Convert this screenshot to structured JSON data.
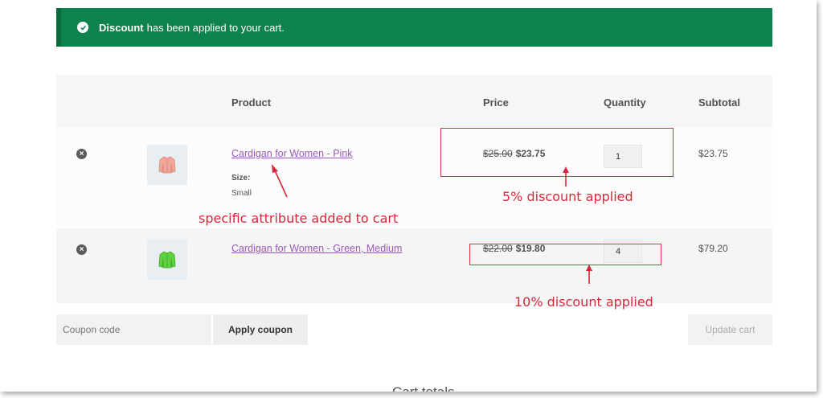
{
  "notice": {
    "strong": "Discount",
    "text": "has been applied to your cart.",
    "color": "#0f834d"
  },
  "table": {
    "headers": {
      "product": "Product",
      "price": "Price",
      "quantity": "Quantity",
      "subtotal": "Subtotal"
    }
  },
  "items": [
    {
      "name": "Cardigan for Women - Pink",
      "meta_label": "Size:",
      "meta_value": "Small",
      "old_price": "$25.00",
      "price": "$23.75",
      "quantity": "1",
      "subtotal": "$23.75",
      "remove_icon": "×",
      "thumb_icon": "pink-cardigan-icon"
    },
    {
      "name": "Cardigan for Women - Green, Medium",
      "old_price": "$22.00",
      "price": "$19.80",
      "quantity": "4",
      "subtotal": "$79.20",
      "remove_icon": "×",
      "thumb_icon": "green-cardigan-icon"
    }
  ],
  "annotations": {
    "attribute": "specific attribute  added to cart",
    "discount5": "5% discount applied",
    "discount10": "10% discount applied",
    "color": "#d7273a"
  },
  "actions": {
    "coupon_placeholder": "Coupon code",
    "apply": "Apply coupon",
    "update": "Update cart"
  },
  "cart_totals": "Cart totals"
}
